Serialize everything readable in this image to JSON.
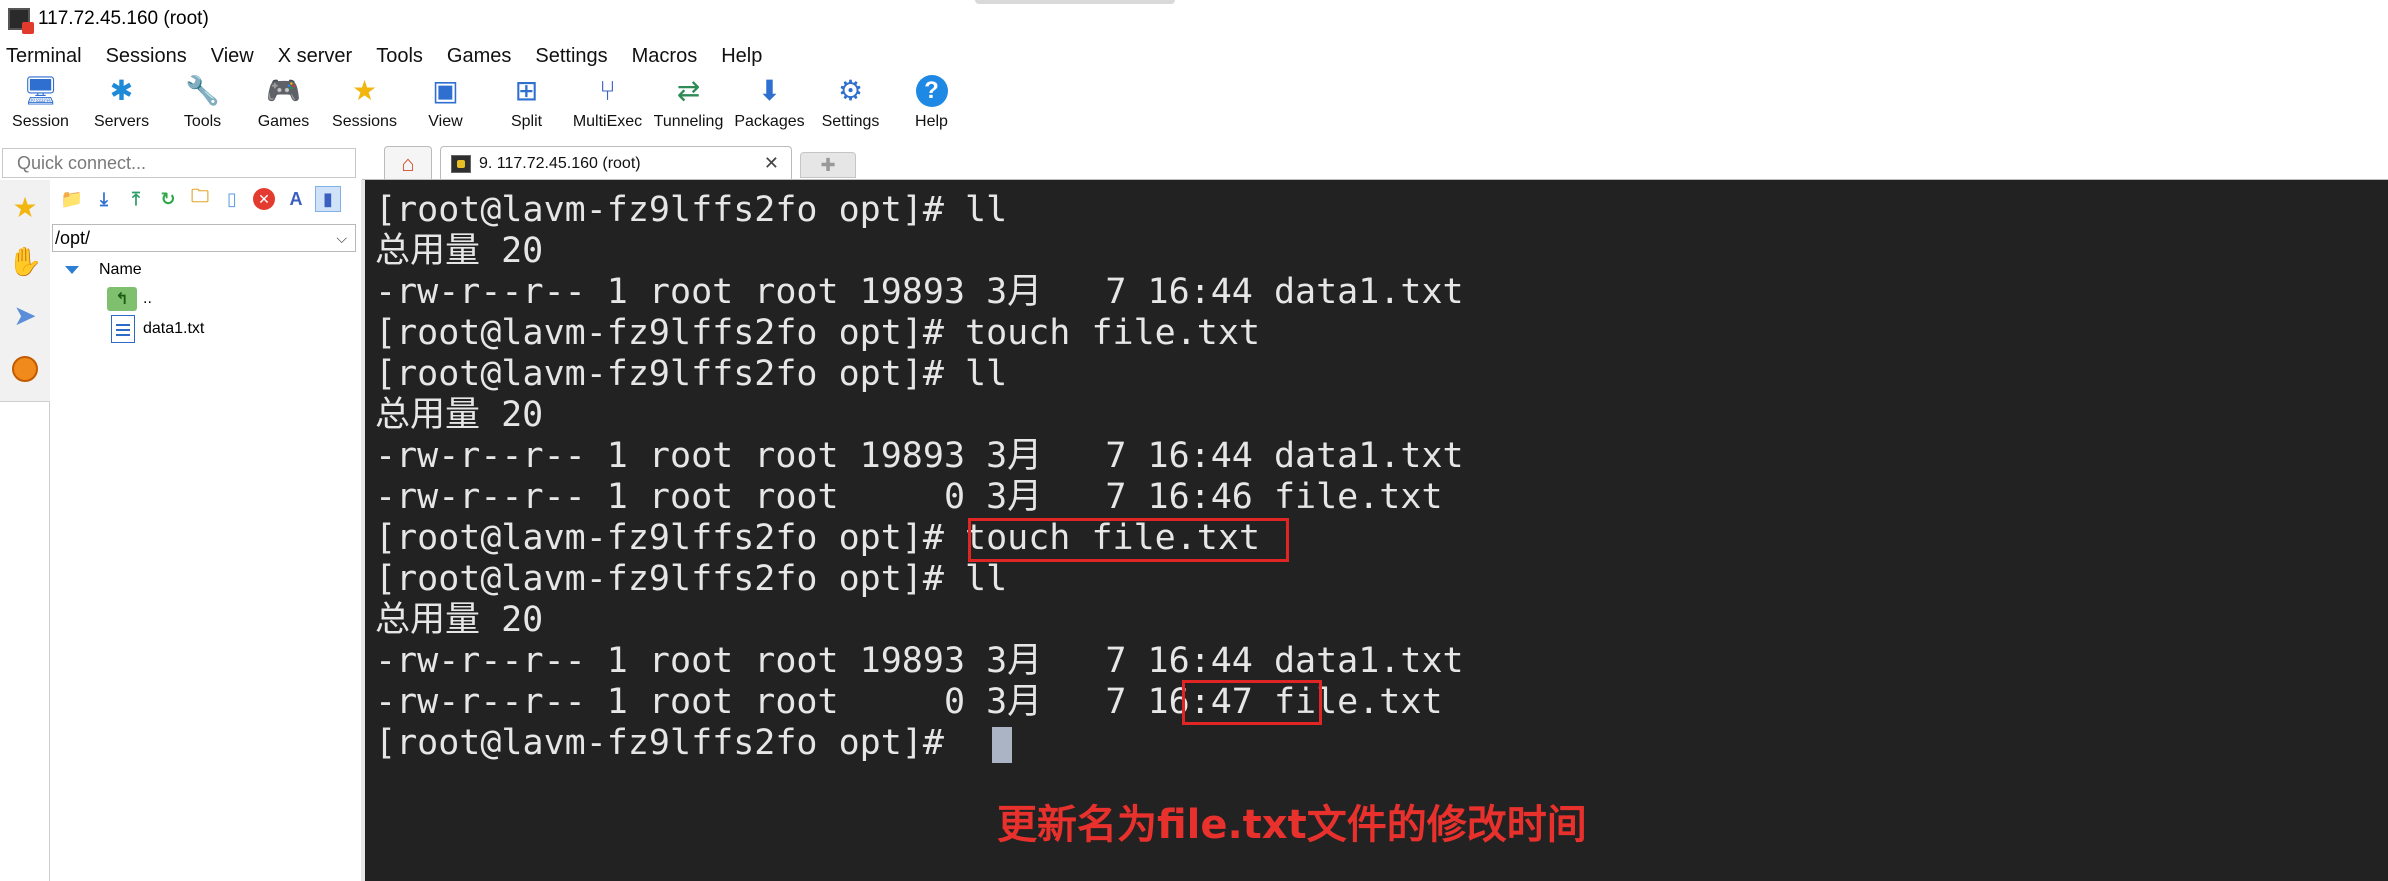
{
  "window": {
    "title": "117.72.45.160 (root)"
  },
  "menu": [
    "Terminal",
    "Sessions",
    "View",
    "X server",
    "Tools",
    "Games",
    "Settings",
    "Macros",
    "Help"
  ],
  "toolbar": [
    {
      "label": "Session",
      "icon": "session-icon"
    },
    {
      "label": "Servers",
      "icon": "servers-icon"
    },
    {
      "label": "Tools",
      "icon": "tools-icon"
    },
    {
      "label": "Games",
      "icon": "games-icon"
    },
    {
      "label": "Sessions",
      "icon": "star-icon"
    },
    {
      "label": "View",
      "icon": "view-icon"
    },
    {
      "label": "Split",
      "icon": "split-icon"
    },
    {
      "label": "MultiExec",
      "icon": "multiexec-icon"
    },
    {
      "label": "Tunneling",
      "icon": "tunneling-icon"
    },
    {
      "label": "Packages",
      "icon": "packages-icon"
    },
    {
      "label": "Settings",
      "icon": "settings-icon"
    },
    {
      "label": "Help",
      "icon": "help-icon"
    }
  ],
  "quick_connect": {
    "placeholder": "Quick connect..."
  },
  "tabs": {
    "active_label": "9. 117.72.45.160 (root)"
  },
  "browser": {
    "path": "/opt/",
    "column_name": "Name",
    "items": [
      "..",
      "data1.txt"
    ]
  },
  "terminal": {
    "lines": [
      "[root@lavm-fz9lffs2fo opt]# ll",
      "总用量 20",
      "-rw-r--r-- 1 root root 19893 3月   7 16:44 data1.txt",
      "[root@lavm-fz9lffs2fo opt]# touch file.txt",
      "[root@lavm-fz9lffs2fo opt]# ll",
      "总用量 20",
      "-rw-r--r-- 1 root root 19893 3月   7 16:44 data1.txt",
      "-rw-r--r-- 1 root root     0 3月   7 16:46 file.txt",
      "[root@lavm-fz9lffs2fo opt]# touch file.txt",
      "[root@lavm-fz9lffs2fo opt]# ll",
      "总用量 20",
      "-rw-r--r-- 1 root root 19893 3月   7 16:44 data1.txt",
      "-rw-r--r-- 1 root root     0 3月   7 16:47 file.txt",
      "[root@lavm-fz9lffs2fo opt]# "
    ],
    "annotation": "更新名为file.txt文件的修改时间"
  },
  "colors": {
    "terminal_bg": "#222222",
    "terminal_fg": "#e6e6e6",
    "highlight": "#e02525"
  }
}
